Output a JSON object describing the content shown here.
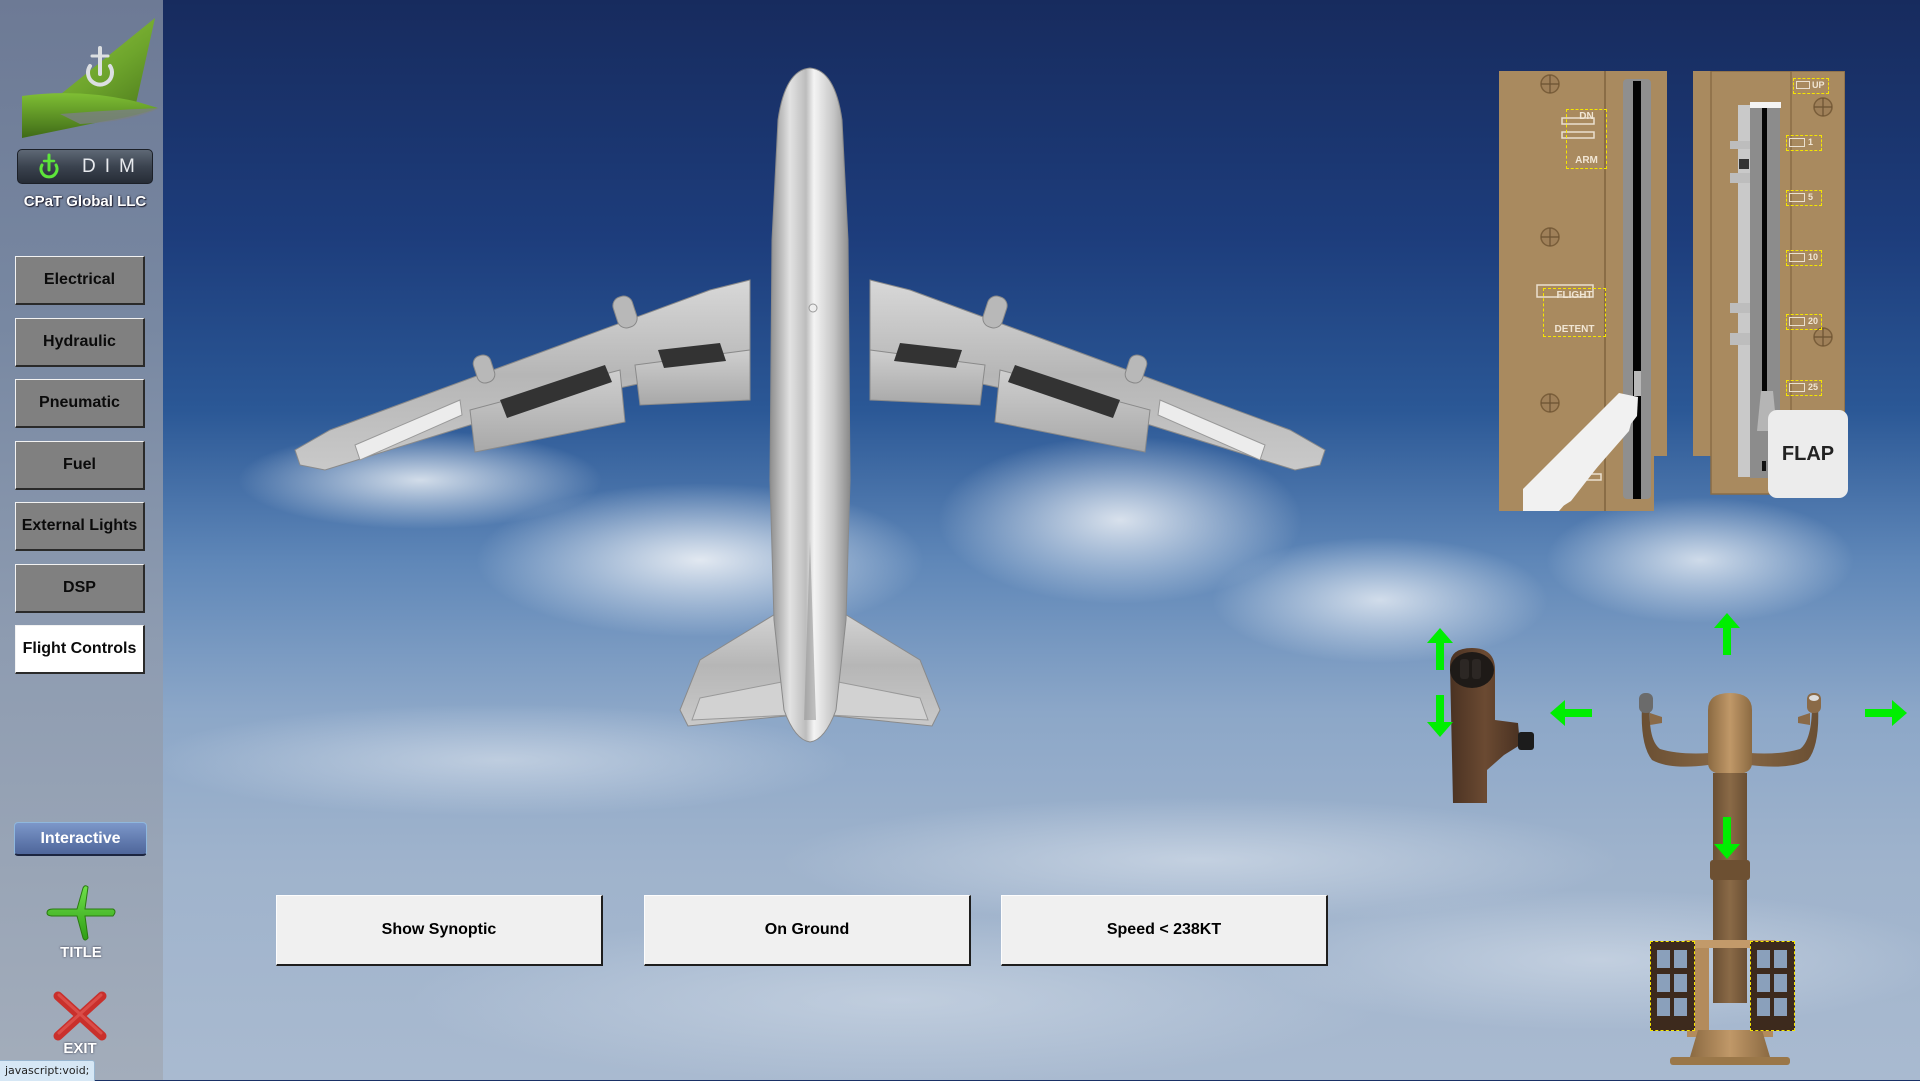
{
  "app": {
    "logo_text": "DIM",
    "company": "CPaT Global LLC"
  },
  "sidebar": {
    "items": [
      {
        "label": "Electrical",
        "active": false
      },
      {
        "label": "Hydraulic",
        "active": false
      },
      {
        "label": "Pneumatic",
        "active": false
      },
      {
        "label": "Fuel",
        "active": false
      },
      {
        "label": "External Lights",
        "active": false
      },
      {
        "label": "DSP",
        "active": false
      },
      {
        "label": "Flight Controls",
        "active": true
      }
    ],
    "mode_button": "Interactive",
    "title_button": "TITLE",
    "exit_button": "EXIT"
  },
  "statusbar": {
    "text": "javascript:void;"
  },
  "actions": {
    "show_synoptic": "Show Synoptic",
    "on_ground": "On Ground",
    "speed": "Speed < 238KT"
  },
  "speedbrake_panel": {
    "labels": {
      "dn": "DN",
      "arm": "ARM",
      "flight": "FLIGHT",
      "detent": "DETENT"
    }
  },
  "flap_panel": {
    "detents": [
      "UP",
      "1",
      "5",
      "10",
      "20",
      "25"
    ],
    "label": "FLAP"
  },
  "colors": {
    "accent_green": "#00ee00",
    "panel_tan": "#a98a5f",
    "sidebar_active": "#ffffff",
    "sidebar_inactive": "#808080"
  },
  "icons": {
    "logo": "power-plane-icon",
    "title": "airplane-icon",
    "exit": "close-icon"
  }
}
